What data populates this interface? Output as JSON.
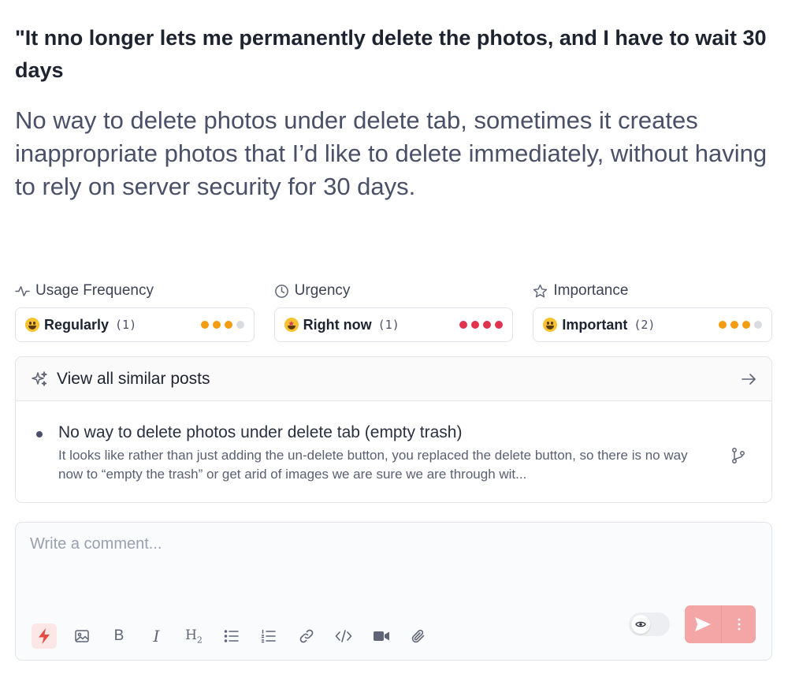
{
  "post": {
    "title": "\"It nno longer lets me permanently delete the photos, and I have to wait 30 days",
    "body": "No way to delete photos under delete tab, sometimes it creates inappropriate photos that I’d like to delete immediately, without having to rely on server security for 30 days."
  },
  "meta": [
    {
      "label": "Usage Frequency",
      "icon": "activity-icon",
      "value": "Regularly",
      "count": "(1)",
      "emoji": "smiley",
      "dots": [
        "#f39c12",
        "#f39c12",
        "#f39c12",
        "#d9dbe0"
      ]
    },
    {
      "label": "Urgency",
      "icon": "clock-icon",
      "value": "Right now",
      "count": "(1)",
      "emoji": "star-struck",
      "dots": [
        "#e0334f",
        "#e0334f",
        "#e0334f",
        "#e0334f"
      ]
    },
    {
      "label": "Importance",
      "icon": "star-icon",
      "value": "Important",
      "count": "(2)",
      "emoji": "smiley",
      "dots": [
        "#f39c12",
        "#f39c12",
        "#f39c12",
        "#d9dbe0"
      ]
    }
  ],
  "similar": {
    "header": "View all similar posts",
    "items": [
      {
        "title": "No way to delete photos under delete tab (empty trash)",
        "excerpt": "It looks like rather than just adding the un-delete button, you replaced the delete button, so there is no way now to “empty the trash” or get arid of images we are sure we are through wit..."
      }
    ]
  },
  "comment": {
    "placeholder": "Write a comment...",
    "tools": [
      "lightning-icon",
      "image-icon",
      "bold-icon",
      "italic-icon",
      "heading-icon",
      "bullet-list-icon",
      "numbered-list-icon",
      "link-icon",
      "code-icon",
      "video-icon",
      "attachment-icon"
    ],
    "accent": "#f4a5a5"
  }
}
